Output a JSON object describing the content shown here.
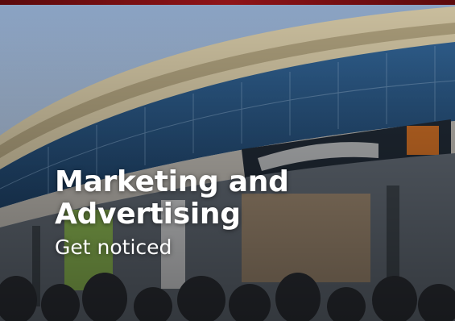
{
  "card": {
    "title_line1": "Marketing and",
    "title_line2": "Advertising",
    "subtitle": "Get noticed",
    "image_icon": "stadium-photo"
  },
  "colors": {
    "frame": "#7a0f12",
    "text": "#ffffff"
  }
}
